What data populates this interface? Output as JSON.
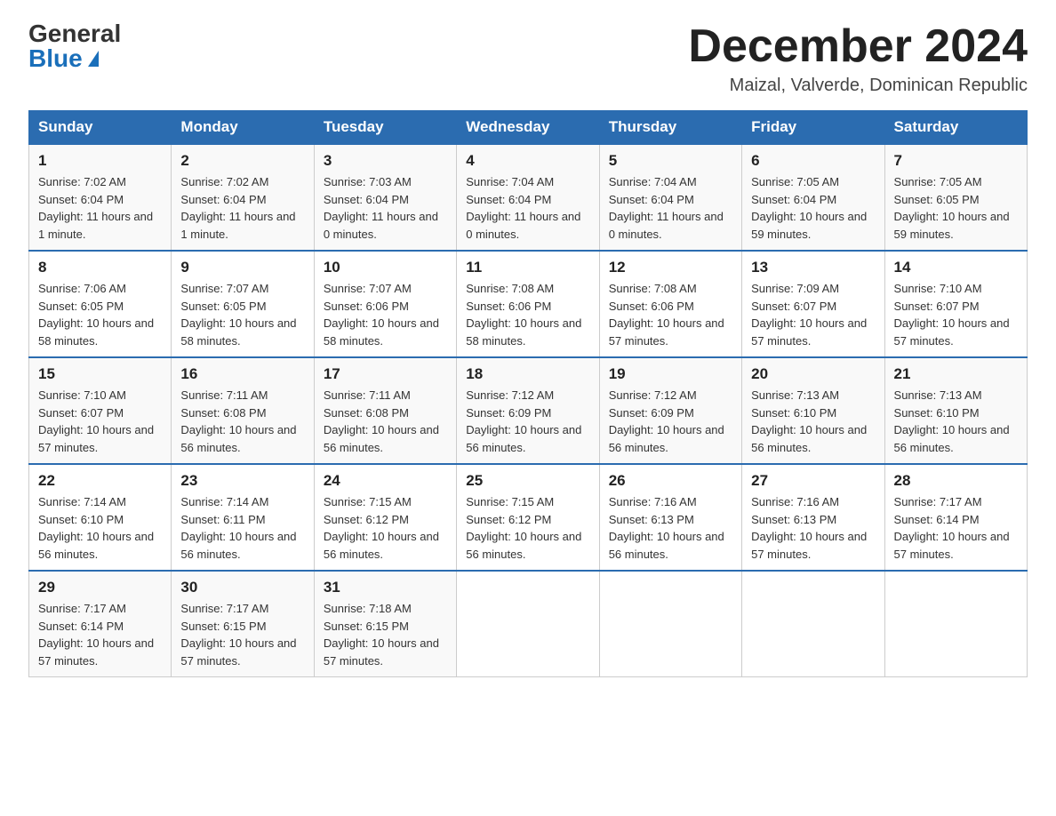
{
  "header": {
    "logo_general": "General",
    "logo_blue": "Blue",
    "month_title": "December 2024",
    "location": "Maizal, Valverde, Dominican Republic"
  },
  "days_of_week": [
    "Sunday",
    "Monday",
    "Tuesday",
    "Wednesday",
    "Thursday",
    "Friday",
    "Saturday"
  ],
  "weeks": [
    [
      {
        "day": "1",
        "sunrise": "7:02 AM",
        "sunset": "6:04 PM",
        "daylight": "11 hours and 1 minute."
      },
      {
        "day": "2",
        "sunrise": "7:02 AM",
        "sunset": "6:04 PM",
        "daylight": "11 hours and 1 minute."
      },
      {
        "day": "3",
        "sunrise": "7:03 AM",
        "sunset": "6:04 PM",
        "daylight": "11 hours and 0 minutes."
      },
      {
        "day": "4",
        "sunrise": "7:04 AM",
        "sunset": "6:04 PM",
        "daylight": "11 hours and 0 minutes."
      },
      {
        "day": "5",
        "sunrise": "7:04 AM",
        "sunset": "6:04 PM",
        "daylight": "11 hours and 0 minutes."
      },
      {
        "day": "6",
        "sunrise": "7:05 AM",
        "sunset": "6:04 PM",
        "daylight": "10 hours and 59 minutes."
      },
      {
        "day": "7",
        "sunrise": "7:05 AM",
        "sunset": "6:05 PM",
        "daylight": "10 hours and 59 minutes."
      }
    ],
    [
      {
        "day": "8",
        "sunrise": "7:06 AM",
        "sunset": "6:05 PM",
        "daylight": "10 hours and 58 minutes."
      },
      {
        "day": "9",
        "sunrise": "7:07 AM",
        "sunset": "6:05 PM",
        "daylight": "10 hours and 58 minutes."
      },
      {
        "day": "10",
        "sunrise": "7:07 AM",
        "sunset": "6:06 PM",
        "daylight": "10 hours and 58 minutes."
      },
      {
        "day": "11",
        "sunrise": "7:08 AM",
        "sunset": "6:06 PM",
        "daylight": "10 hours and 58 minutes."
      },
      {
        "day": "12",
        "sunrise": "7:08 AM",
        "sunset": "6:06 PM",
        "daylight": "10 hours and 57 minutes."
      },
      {
        "day": "13",
        "sunrise": "7:09 AM",
        "sunset": "6:07 PM",
        "daylight": "10 hours and 57 minutes."
      },
      {
        "day": "14",
        "sunrise": "7:10 AM",
        "sunset": "6:07 PM",
        "daylight": "10 hours and 57 minutes."
      }
    ],
    [
      {
        "day": "15",
        "sunrise": "7:10 AM",
        "sunset": "6:07 PM",
        "daylight": "10 hours and 57 minutes."
      },
      {
        "day": "16",
        "sunrise": "7:11 AM",
        "sunset": "6:08 PM",
        "daylight": "10 hours and 56 minutes."
      },
      {
        "day": "17",
        "sunrise": "7:11 AM",
        "sunset": "6:08 PM",
        "daylight": "10 hours and 56 minutes."
      },
      {
        "day": "18",
        "sunrise": "7:12 AM",
        "sunset": "6:09 PM",
        "daylight": "10 hours and 56 minutes."
      },
      {
        "day": "19",
        "sunrise": "7:12 AM",
        "sunset": "6:09 PM",
        "daylight": "10 hours and 56 minutes."
      },
      {
        "day": "20",
        "sunrise": "7:13 AM",
        "sunset": "6:10 PM",
        "daylight": "10 hours and 56 minutes."
      },
      {
        "day": "21",
        "sunrise": "7:13 AM",
        "sunset": "6:10 PM",
        "daylight": "10 hours and 56 minutes."
      }
    ],
    [
      {
        "day": "22",
        "sunrise": "7:14 AM",
        "sunset": "6:10 PM",
        "daylight": "10 hours and 56 minutes."
      },
      {
        "day": "23",
        "sunrise": "7:14 AM",
        "sunset": "6:11 PM",
        "daylight": "10 hours and 56 minutes."
      },
      {
        "day": "24",
        "sunrise": "7:15 AM",
        "sunset": "6:12 PM",
        "daylight": "10 hours and 56 minutes."
      },
      {
        "day": "25",
        "sunrise": "7:15 AM",
        "sunset": "6:12 PM",
        "daylight": "10 hours and 56 minutes."
      },
      {
        "day": "26",
        "sunrise": "7:16 AM",
        "sunset": "6:13 PM",
        "daylight": "10 hours and 56 minutes."
      },
      {
        "day": "27",
        "sunrise": "7:16 AM",
        "sunset": "6:13 PM",
        "daylight": "10 hours and 57 minutes."
      },
      {
        "day": "28",
        "sunrise": "7:17 AM",
        "sunset": "6:14 PM",
        "daylight": "10 hours and 57 minutes."
      }
    ],
    [
      {
        "day": "29",
        "sunrise": "7:17 AM",
        "sunset": "6:14 PM",
        "daylight": "10 hours and 57 minutes."
      },
      {
        "day": "30",
        "sunrise": "7:17 AM",
        "sunset": "6:15 PM",
        "daylight": "10 hours and 57 minutes."
      },
      {
        "day": "31",
        "sunrise": "7:18 AM",
        "sunset": "6:15 PM",
        "daylight": "10 hours and 57 minutes."
      },
      null,
      null,
      null,
      null
    ]
  ]
}
